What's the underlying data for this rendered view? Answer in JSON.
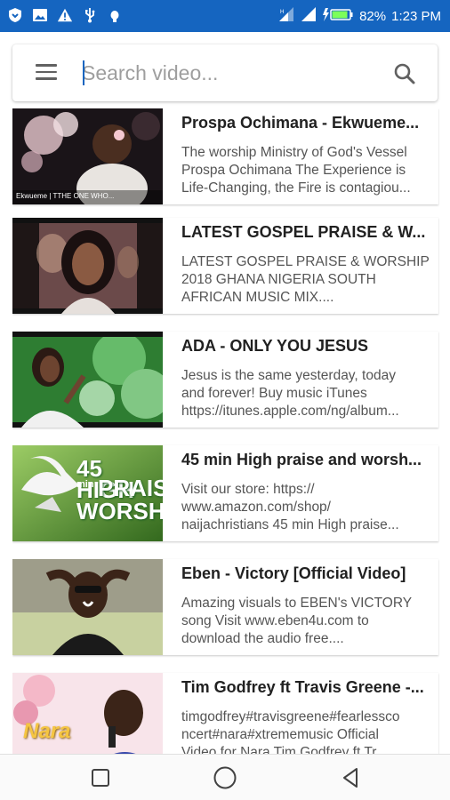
{
  "status_bar": {
    "battery": "82%",
    "time": "1:23 PM",
    "left_icons": [
      "shield-icon",
      "image-icon",
      "warning-icon",
      "usb-icon",
      "bug-icon"
    ],
    "right_icons": [
      "signal-icon",
      "signal-icon",
      "charging-battery-icon"
    ]
  },
  "search": {
    "placeholder": "Search video...",
    "menu_icon": "hamburger-menu-icon",
    "search_icon": "magnifier-icon"
  },
  "videos": [
    {
      "title": "Prospa Ochimana - Ekwueme...",
      "desc": [
        "The worship Ministry of God's Vessel",
        "Prospa Ochimana The Experience is",
        "Life-Changing, the Fire is contagiou..."
      ],
      "thumb_caption": "Ekwueme | TTHE ONE WHO..."
    },
    {
      "title": "LATEST GOSPEL PRAISE & W...",
      "desc": [
        "LATEST GOSPEL PRAISE & WORSHIP",
        "2018 GHANA NIGERIA SOUTH",
        "AFRICAN MUSIC MIX...."
      ]
    },
    {
      "title": "ADA - ONLY YOU JESUS",
      "desc": [
        "Jesus is the same yesterday, today",
        "and forever! Buy music iTunes",
        "https://itunes.apple.com/ng/album..."
      ]
    },
    {
      "title": "45 min High praise and worsh...",
      "desc": [
        "Visit our store: https://",
        "www.amazon.com/shop/",
        "naijachristians 45 min High praise..."
      ],
      "thumb_lines": [
        "45 HIGH",
        "min",
        "PRAIS",
        "WORSH"
      ]
    },
    {
      "title": "Eben - Victory [Official Video]",
      "desc": [
        "Amazing visuals to EBEN's VICTORY",
        "song Visit www.eben4u.com to",
        "download the audio free...."
      ]
    },
    {
      "title": "Tim Godfrey ft Travis Greene -...",
      "desc": [
        "timgodfrey#travisgreene#fearlessco",
        "ncert#nara#xtrememusic Official",
        "Video for Nara Tim Godfrey ft Tr..."
      ],
      "thumb_word": "Nara"
    }
  ],
  "nav": {
    "icons": [
      "recents-square-icon",
      "home-circle-icon",
      "back-triangle-icon"
    ]
  },
  "colors": {
    "status_bar": "#1565c0",
    "accent": "#1565c0"
  }
}
